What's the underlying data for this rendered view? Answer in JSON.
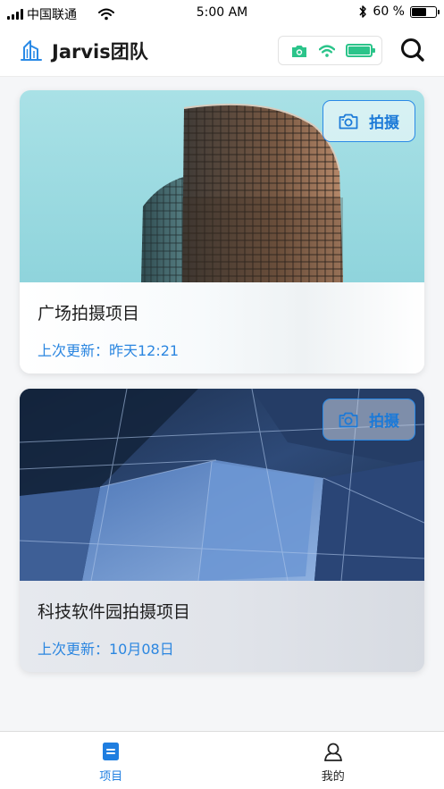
{
  "status_bar": {
    "carrier": "中国联通",
    "time": "5:00 AM",
    "battery_percent": "60 %"
  },
  "header": {
    "title": "Jarvis团队",
    "logo_icon": "building-icon",
    "device_status_icons": [
      "camera-icon",
      "wifi-icon",
      "battery-icon"
    ],
    "search_icon": "search-icon",
    "accent_color": "#2bc48a"
  },
  "projects": [
    {
      "title": "广场拍摄项目",
      "updated": "上次更新：昨天12:21",
      "shoot_label": "拍摄"
    },
    {
      "title": "科技软件园拍摄项目",
      "updated": "上次更新：10月08日",
      "shoot_label": "拍摄"
    }
  ],
  "tab_bar": {
    "tabs": [
      {
        "label": "项目",
        "icon": "list-icon",
        "active": true
      },
      {
        "label": "我的",
        "icon": "user-icon",
        "active": false
      }
    ],
    "active_color": "#1f7ee0"
  }
}
